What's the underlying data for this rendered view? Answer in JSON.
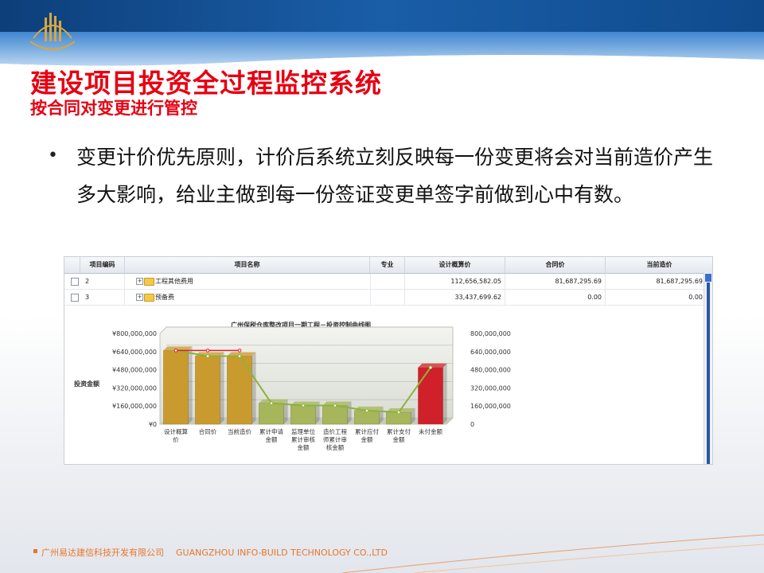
{
  "slide": {
    "title": "建设项目投资全过程监控系统",
    "subtitle": "按合同对变更进行管控",
    "bullet": "变更计价优先原则，计价后系统立刻反映每一份变更将会对当前造价产生多大影响，给业主做到每一份签证变更单签字前做到心中有数。",
    "footer_cn": "广州易达建信科技开发有限公司",
    "footer_en": "GUANGZHOU INFO-BUILD TECHNOLOGY CO.,LTD",
    "colors": {
      "title": "#e60012",
      "accent": "#1f5fa8",
      "footer": "#e8762b"
    }
  },
  "grid": {
    "headers": [
      "项目编码",
      "项目名称",
      "专业",
      "设计概算价",
      "合同价",
      "当前造价"
    ],
    "rows": [
      {
        "code": "2",
        "name": "工程其他费用",
        "design": "112,656,582.05",
        "contract": "81,687,295.69",
        "current": "81,687,295.69"
      },
      {
        "code": "3",
        "name": "预备费",
        "design": "33,437,699.62",
        "contract": "0.00",
        "current": "0.00"
      }
    ]
  },
  "chart_data": {
    "type": "bar",
    "title": "广州保税仓库整改项目一期工程－投资控制曲线图",
    "ylabel": "投资金额",
    "xlabel": "",
    "ylim": [
      0,
      800000000
    ],
    "left_ticks": [
      "¥800,000,000",
      "¥640,000,000",
      "¥480,000,000",
      "¥320,000,000",
      "¥160,000,000",
      "¥0"
    ],
    "right_ticks": [
      "800,000,000",
      "640,000,000",
      "480,000,000",
      "320,000,000",
      "160,000,000",
      "0"
    ],
    "categories": [
      "设计概算价",
      "合同价",
      "当前造价",
      "累计申请金额",
      "监理单位累计审核金额",
      "造价工程师累计审核金额",
      "累计应付金额",
      "累计支付金额",
      "未付金额"
    ],
    "values": [
      650000000,
      600000000,
      600000000,
      185000000,
      165000000,
      165000000,
      120000000,
      105000000,
      500000000
    ],
    "bar_colors": [
      "#c99a2e",
      "#c99a2e",
      "#c99a2e",
      "#a6b65a",
      "#a6b65a",
      "#a6b65a",
      "#a6b65a",
      "#a6b65a",
      "#d0202a"
    ],
    "series": [
      {
        "values": [
          650000000,
          600000000,
          600000000,
          185000000,
          165000000,
          165000000,
          120000000,
          105000000,
          500000000
        ]
      },
      {
        "values": [
          650000000,
          650000000,
          650000000
        ]
      }
    ],
    "grid": true
  }
}
